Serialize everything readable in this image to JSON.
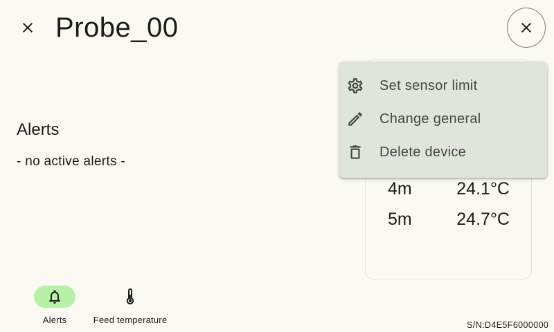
{
  "header": {
    "title": "Probe_00",
    "close_left_icon": "close-icon",
    "close_right_icon": "close-icon"
  },
  "alerts": {
    "heading": "Alerts",
    "empty_text": "- no active alerts -"
  },
  "readings": [
    {
      "time": "4m",
      "value": "24.1°C"
    },
    {
      "time": "5m",
      "value": "24.7°C"
    }
  ],
  "menu": {
    "items": [
      {
        "label": "Set sensor limit",
        "icon": "gear-icon"
      },
      {
        "label": "Change general",
        "icon": "pencil-icon"
      },
      {
        "label": "Delete device",
        "icon": "trash-icon"
      }
    ]
  },
  "nav": {
    "items": [
      {
        "label": "Alerts",
        "icon": "bell-icon",
        "active": true
      },
      {
        "label": "Feed temperature",
        "icon": "thermometer-icon",
        "active": false
      }
    ]
  },
  "footer": {
    "serial": "S/N:D4E5F6000000"
  },
  "colors": {
    "background": "#fafaf2",
    "menu_background": "#dfe5dc",
    "active_nav": "#b6f1a7",
    "text": "#1b1c18"
  }
}
